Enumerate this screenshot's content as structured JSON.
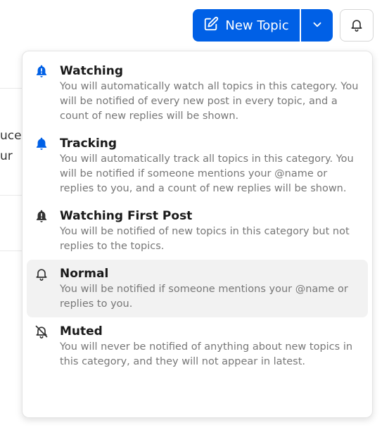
{
  "toolbar": {
    "new_topic_label": "New Topic"
  },
  "background": {
    "line1": "uce",
    "line2": "ur"
  },
  "menu": {
    "items": [
      {
        "title": "Watching",
        "description": "You will automatically watch all topics in this category. You will be notified of every new post in every topic, and a count of new replies will be shown.",
        "icon": "bell-exclamation-icon"
      },
      {
        "title": "Tracking",
        "description": "You will automatically track all topics in this category. You will be notified if someone mentions your @name or replies to you, and a count of new replies will be shown.",
        "icon": "bell-filled-icon"
      },
      {
        "title": "Watching First Post",
        "description": "You will be notified of new topics in this category but not replies to the topics.",
        "icon": "bell-exclamation-icon"
      },
      {
        "title": "Normal",
        "description": "You will be notified if someone mentions your @name or replies to you.",
        "icon": "bell-outline-icon"
      },
      {
        "title": "Muted",
        "description": "You will never be notified of anything about new topics in this category, and they will not appear in latest.",
        "icon": "bell-slash-icon"
      }
    ]
  },
  "colors": {
    "primary": "#0060e6",
    "watching_icon": "#0060e6",
    "tracking_icon": "#0060e6",
    "neutral_icon": "#333333",
    "description_text": "#777777",
    "highlight_row": "#f2f2f2"
  }
}
